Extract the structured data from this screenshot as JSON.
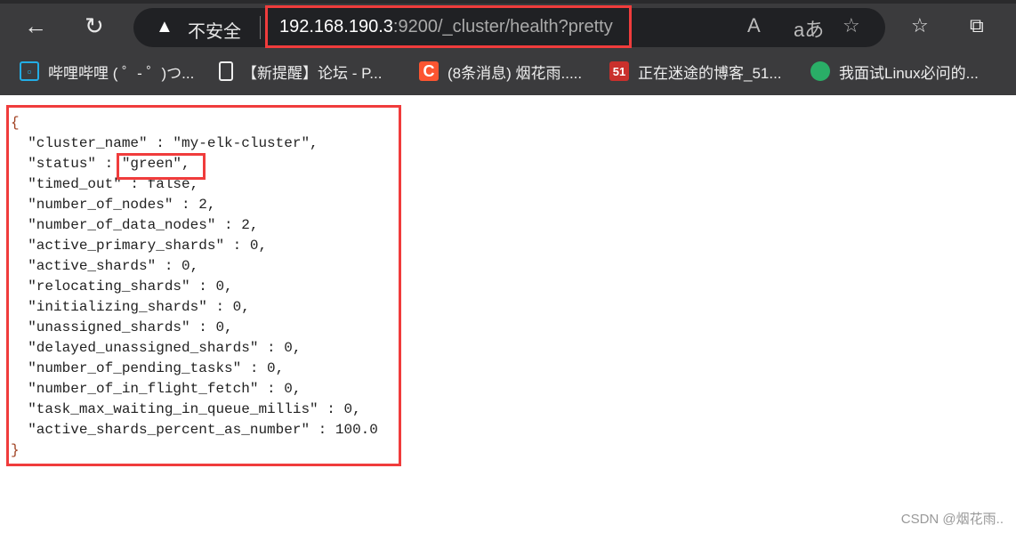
{
  "browser": {
    "security_label": "不安全",
    "url_host": "192.168.190.3",
    "url_rest": ":9200/_cluster/health?pretty",
    "bookmarks": [
      {
        "label": "哔哩哔哩 ( ゜- ゜)つ...",
        "icon": "bilibili-icon"
      },
      {
        "label": "【新提醒】论坛 - P...",
        "icon": "page-icon"
      },
      {
        "label": "(8条消息) 烟花雨.....",
        "icon": "csdn-icon",
        "badge": "C"
      },
      {
        "label": "正在迷途的博客_51...",
        "icon": "51cto-icon",
        "badge": "51"
      },
      {
        "label": "我面试Linux必问的...",
        "icon": "wechat-icon"
      }
    ]
  },
  "json": {
    "open": "{",
    "close": "}",
    "lines": [
      "\"cluster_name\" : \"my-elk-cluster\",",
      "\"status\" : \"green\",",
      "\"timed_out\" : false,",
      "\"number_of_nodes\" : 2,",
      "\"number_of_data_nodes\" : 2,",
      "\"active_primary_shards\" : 0,",
      "\"active_shards\" : 0,",
      "\"relocating_shards\" : 0,",
      "\"initializing_shards\" : 0,",
      "\"unassigned_shards\" : 0,",
      "\"delayed_unassigned_shards\" : 0,",
      "\"number_of_pending_tasks\" : 0,",
      "\"number_of_in_flight_fetch\" : 0,",
      "\"task_max_waiting_in_queue_millis\" : 0,",
      "\"active_shards_percent_as_number\" : 100.0"
    ]
  },
  "watermark": "CSDN @烟花雨.."
}
